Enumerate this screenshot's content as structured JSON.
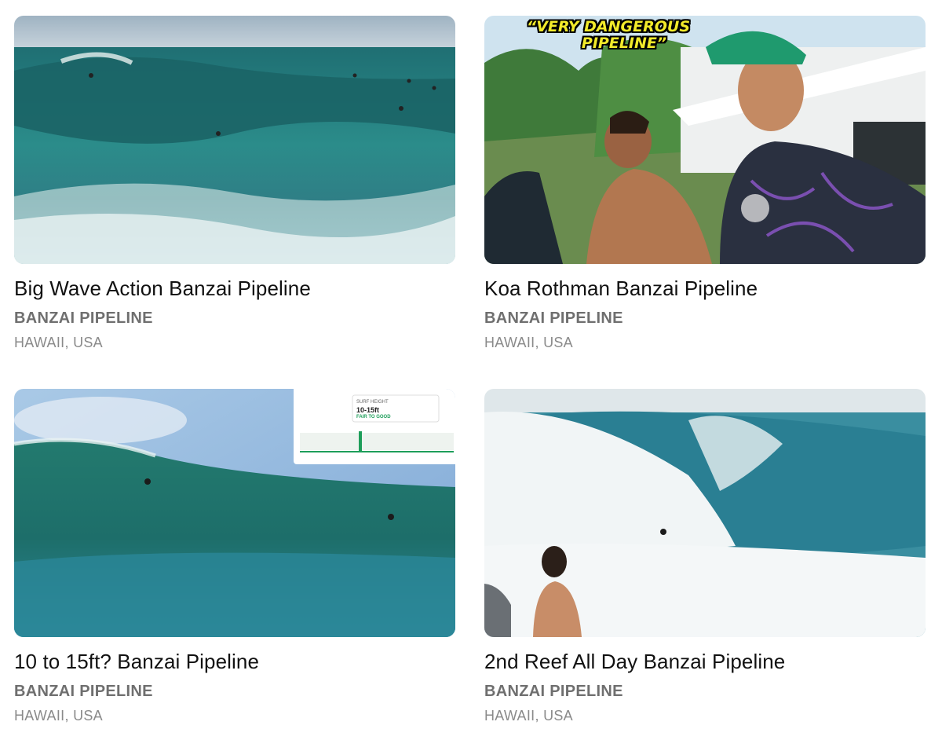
{
  "cards": [
    {
      "title": "Big Wave Action Banzai Pipeline",
      "spot": "BANZAI PIPELINE",
      "region": "HAWAII, USA",
      "thumbnail": "ocean-wave-surfers"
    },
    {
      "title": "Koa Rothman Banzai Pipeline",
      "spot": "BANZAI PIPELINE",
      "region": "HAWAII, USA",
      "thumbnail": "two-surfers-beachside",
      "thumb_caption_line1": "“VERY DANGEROUS",
      "thumb_caption_line2": "PIPELINE”"
    },
    {
      "title": "10 to 15ft? Banzai Pipeline",
      "spot": "BANZAI PIPELINE",
      "region": "HAWAII, USA",
      "thumbnail": "barrel-wave-forecast-overlay",
      "overlay_label": "SURF HEIGHT",
      "overlay_height": "10-15ft",
      "overlay_rating": "FAIR TO GOOD"
    },
    {
      "title": "2nd Reef All Day Banzai Pipeline",
      "spot": "BANZAI PIPELINE",
      "region": "HAWAII, USA",
      "thumbnail": "crashing-wave-spectators"
    }
  ],
  "colors": {
    "title": "#111111",
    "spot": "#6f6f6f",
    "region": "#8a8a8a",
    "caption_yellow": "#f2ea2a",
    "forecast_green": "#1e9e5a"
  }
}
